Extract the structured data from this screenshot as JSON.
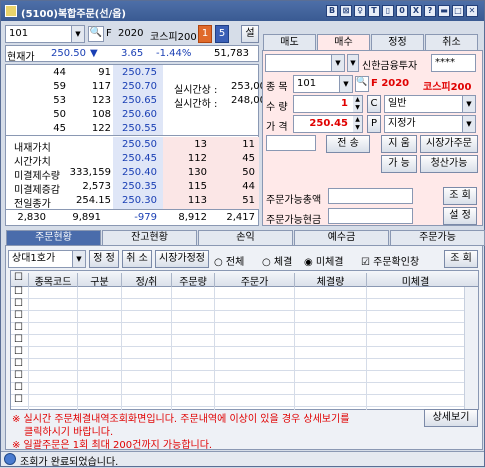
{
  "window": {
    "title": "(5100)복합주문(선/옵)",
    "title_btns": [
      "B",
      "⊠",
      "♀",
      "T",
      "▯",
      "0",
      "X",
      "?",
      "▬",
      "□",
      "✕"
    ]
  },
  "top": {
    "code": "101",
    "kind": "F",
    "year": "2020",
    "product": "코스피200",
    "num1": "1",
    "num5": "5",
    "set": "설"
  },
  "quote": {
    "cur_label": "현재가",
    "cur_price": "250.50",
    "arrow": "▼",
    "change": "3.65",
    "rate": "-1.44%",
    "volume": "51,783"
  },
  "hoga": [
    {
      "a": "44",
      "b": "91",
      "p": "250.75"
    },
    {
      "a": "59",
      "b": "117",
      "p": "250.70"
    },
    {
      "a": "53",
      "b": "123",
      "p": "250.65"
    },
    {
      "a": "50",
      "b": "108",
      "p": "250.60"
    },
    {
      "a": "45",
      "b": "122",
      "p": "250.55"
    }
  ],
  "limits": {
    "up_label": "실시간상 :",
    "up_val": "253,00",
    "dn_label": "실시간하 :",
    "dn_val": "248,00"
  },
  "bottom_rows": [
    {
      "label": "내재가치",
      "v2": "",
      "p": "250.50",
      "c": "13",
      "d": "11"
    },
    {
      "label": "시간가치",
      "v2": "",
      "p": "250.45",
      "c": "112",
      "d": "45"
    },
    {
      "label": "미결제수량",
      "v2": "333,159",
      "p": "250.40",
      "c": "130",
      "d": "50"
    },
    {
      "label": "미결제증감",
      "v2": "2,573",
      "p": "250.35",
      "c": "115",
      "d": "44"
    },
    {
      "label": "전일종가",
      "v2": "254.15",
      "p": "250.30",
      "c": "113",
      "d": "51"
    }
  ],
  "totals": {
    "a": "2,830",
    "b": "9,891",
    "p": "-979",
    "c": "8,912",
    "d": "2,417"
  },
  "order_tabs": [
    "매도",
    "매수",
    "정정",
    "취소"
  ],
  "order": {
    "account_name": "신한금융투자",
    "pw": "****",
    "code_label": "종 목",
    "code": "101",
    "fut_label": "F 2020",
    "fut_name": "코스피200",
    "qty_label": "수 량",
    "qty": "1",
    "type_btn": "C",
    "type": "일반",
    "price_label": "가 격",
    "price": "250.45",
    "p_btn": "P",
    "cond": "지정가",
    "send": "전 송",
    "clear": "지 움",
    "market": "시장가주문",
    "avail": "가 능",
    "liquidate": "청산가능",
    "total_label": "주문가능총액",
    "cash_label": "주문가능현금",
    "query": "조 회",
    "setting": "설 정"
  },
  "lower_tabs": [
    "주문현황",
    "잔고현황",
    "손익",
    "예수금",
    "주문가능"
  ],
  "filter": {
    "sel": "상대1호가",
    "fix": "정 정",
    "cancel": "취 소",
    "market_fix": "시장가정정",
    "all": "전체",
    "done": "체결",
    "undone": "미체결",
    "confirm": "주문확인창",
    "query": "조 회"
  },
  "columns": [
    "종목코드",
    "구분",
    "정/취",
    "주문량",
    "주문가",
    "체결량",
    "미체결"
  ],
  "notice": {
    "l1": "※ 실시간 주문체결내역조회화면입니다. 주문내역에 이상이 있을 경우 상세보기를",
    "l2": "클릭하시기 바랍니다.",
    "l3": "※ 일괄주문은 1회 최대 200건까지 가능합니다.",
    "detail": "상세보기"
  },
  "status": "조회가 완료되었습니다."
}
